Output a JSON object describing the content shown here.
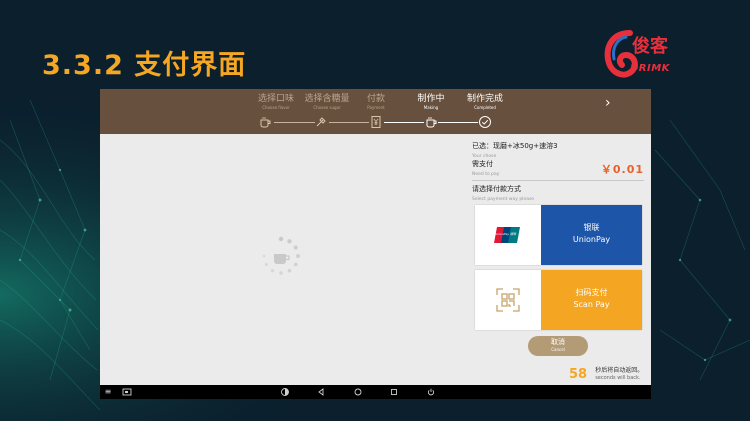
{
  "slide": {
    "title": "3.3.2 支付界面"
  },
  "logo": {
    "brand_cn": "俊客",
    "brand_en": "DRIMK"
  },
  "steps": [
    {
      "label_cn": "选择口味",
      "label_en": "Choose flavor",
      "icon": "cup-icon",
      "active": false
    },
    {
      "label_cn": "选择含糖量",
      "label_en": "Choose sugar",
      "icon": "sugar-spoon-icon",
      "active": false
    },
    {
      "label_cn": "付款",
      "label_en": "Payment",
      "icon": "yuan-receipt-icon",
      "active": false
    },
    {
      "label_cn": "制作中",
      "label_en": "Making",
      "icon": "cup-icon",
      "active": true
    },
    {
      "label_cn": "制作完成",
      "label_en": "Completed",
      "icon": "check-circle-icon",
      "active": true
    }
  ],
  "order": {
    "selected_cn": "已选：现磨+冰50g+速溶3",
    "selected_en": "Your chose",
    "need_pay_cn": "需支付",
    "need_pay_en": "Need to pay",
    "amount": "￥0.01",
    "choose_method_cn": "请选择付款方式",
    "choose_method_en": "Select payment way please"
  },
  "payment_methods": [
    {
      "name_cn": "银联",
      "name_en": "UnionPay",
      "color": "#1d55a8",
      "icon": "unionpay-logo-icon",
      "logo_text": "UnionPay 银联"
    },
    {
      "name_cn": "扫码支付",
      "name_en": "Scan Pay",
      "color": "#f4a623",
      "icon": "qr-scan-icon"
    }
  ],
  "cancel": {
    "label_cn": "取消",
    "label_en": "Cancel"
  },
  "countdown": {
    "seconds": "58",
    "msg_cn": "秒后将自动返回。",
    "msg_en": "seconds will back."
  },
  "colors": {
    "topbar": "#67503d",
    "accent_orange": "#f5a623",
    "amount": "#e8602a",
    "cancel_button": "#b39b76",
    "unionpay_blue": "#1d55a8"
  },
  "navbar": {
    "icons": [
      "menu-icon",
      "screenshot-icon",
      "half-circle-icon",
      "back-icon",
      "home-icon",
      "recents-icon",
      "power-icon"
    ]
  }
}
